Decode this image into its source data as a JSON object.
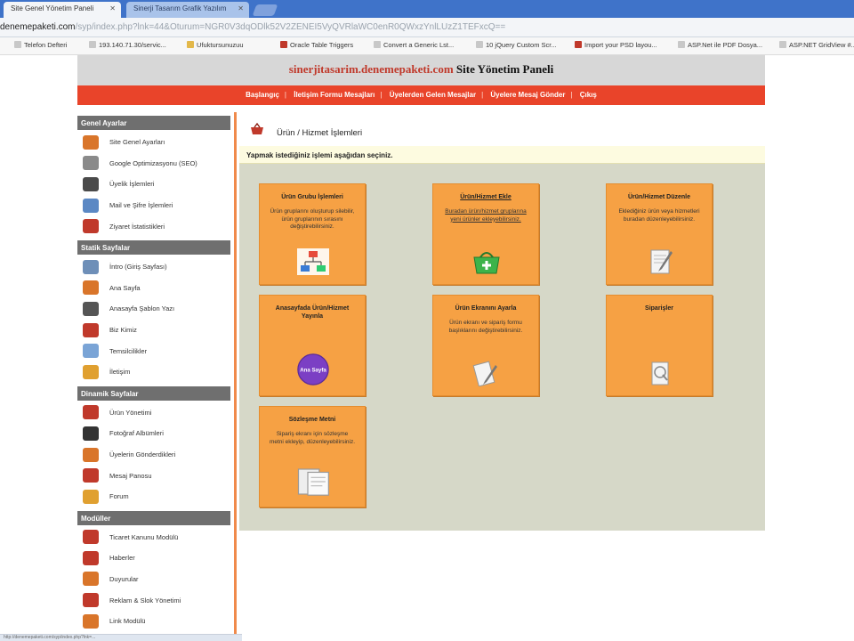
{
  "browser": {
    "tabs": [
      {
        "label": "Site Genel Yönetim Paneli"
      },
      {
        "label": "Sinerji Tasarım Grafik Yazılım"
      }
    ],
    "url_host": "denemepaketi.com",
    "url_rest": "/syp/index.php?lnk=44&Oturum=NGR0V3dqODlk52V2ZENEI5VyQVRlaWC0enR0QWxzYnlLUzZ1TEFxcQ==",
    "bookmarks": [
      "Telefon Defteri",
      "193.140.71.30/servic...",
      "Ufuktursunuzuu",
      "Oracle Table Triggers",
      "Convert a Generic Lst...",
      "10 jQuery Custom Scr...",
      "Import your PSD layou...",
      "ASP.Net ile PDF Dosya...",
      "ASP.NET GridView #..."
    ]
  },
  "header": {
    "site": "sinerjitasarim.denemepaketi.com",
    "rest": "Site Yönetim Paneli"
  },
  "menu": [
    "Başlangıç",
    "İletişim Formu Mesajları",
    "Üyelerden Gelen Mesajlar",
    "Üyelere Mesaj Gönder",
    "Çıkış"
  ],
  "sidebar": {
    "sections": [
      {
        "title": "Genel Ayarlar",
        "items": [
          "Site Genel Ayarları",
          "Google Optimizasyonu (SEO)",
          "Üyelik İşlemleri",
          "Mail ve Şifre İşlemleri",
          "Ziyaret İstatistikleri"
        ]
      },
      {
        "title": "Statik Sayfalar",
        "items": [
          "İntro (Giriş Sayfası)",
          "Ana Sayfa",
          "Anasayfa Şablon Yazı",
          "Biz Kimiz",
          "Temsilcilikler",
          "İletişim"
        ]
      },
      {
        "title": "Dinamik Sayfalar",
        "items": [
          "Ürün Yönetimi",
          "Fotoğraf Albümleri",
          "Üyelerin Gönderdikleri",
          "Mesaj Panosu",
          "Forum"
        ]
      },
      {
        "title": "Modüller",
        "items": [
          "Ticaret Kanunu Modülü",
          "Haberler",
          "Duyurular",
          "Reklam & Slok Yönetimi",
          "Link Modülü"
        ]
      }
    ]
  },
  "content": {
    "title": "Ürün / Hizmet İşlemleri",
    "notice": "Yapmak istediğiniz işlemi aşağıdan seçiniz.",
    "cards": [
      {
        "title": "Ürün Grubu İşlemleri",
        "desc": "Ürün gruplarını oluşturup silebilir, ürün gruplarının sırasını değiştirebilirsiniz.",
        "icon": "sitemap-icon"
      },
      {
        "title": "Ürün/Hizmet Ekle",
        "desc": "Buradan ürün/hizmet gruplarına yeni ürünler ekleyebilirsiniz.",
        "icon": "add-basket-icon"
      },
      {
        "title": "Ürün/Hizmet Düzenle",
        "desc": "Eklediğiniz ürün veya hizmetleri buradan düzenleyebilirsiniz.",
        "icon": "edit-document-icon"
      },
      {
        "title": "Anasayfada Ürün/Hizmet Yayınla",
        "desc": "",
        "badge": "Ana Sayfa",
        "icon": "home-badge-icon"
      },
      {
        "title": "Ürün Ekranını Ayarla",
        "desc": "Ürün ekranı ve sipariş formu başlıklarını değiştirebilirsiniz.",
        "icon": "settings-document-icon"
      },
      {
        "title": "Siparişler",
        "desc": "",
        "icon": "orders-icon"
      },
      {
        "title": "Sözleşme Metni",
        "desc": "Sipariş ekranı için sözleşme metni ekleyip, düzenleyebilirsiniz.",
        "icon": "contract-icon"
      }
    ]
  },
  "status": "http://denemepaketi.com/syp/index.php?lnk=..."
}
